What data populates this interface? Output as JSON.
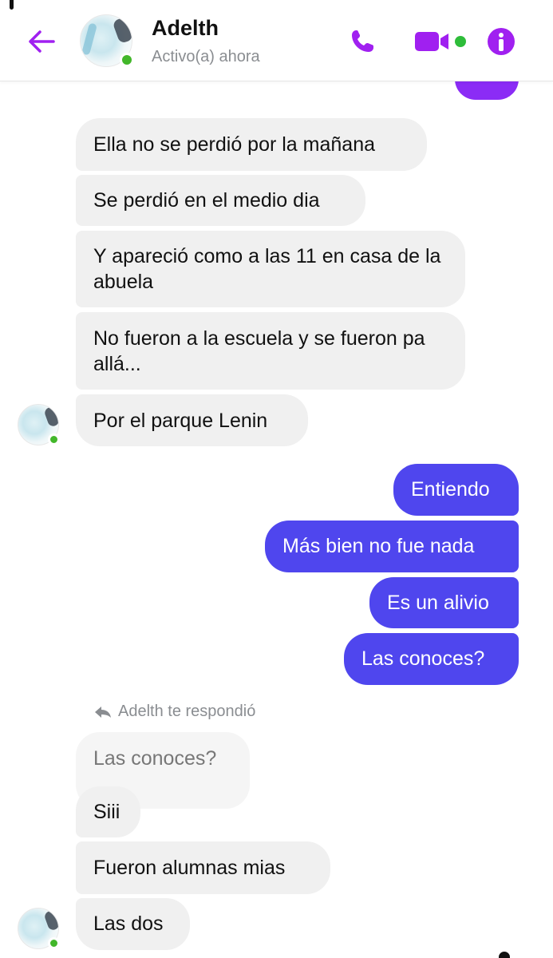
{
  "header": {
    "contact_name": "Adelth",
    "status": "Activo(a) ahora",
    "icons": [
      "back-arrow-icon",
      "phone-icon",
      "video-camera-icon",
      "info-icon"
    ]
  },
  "colors": {
    "accent": "#a020f0",
    "outgoing_bubble": "#4f46ee",
    "incoming_bubble": "#f0f0f0",
    "online": "#42b72a"
  },
  "messages": {
    "m1": "Ella no se perdió por la mañana",
    "m2": "Se perdió en el medio dia",
    "m3": "Y apareció como a las 11 en casa de la abuela",
    "m4": "No fueron a la escuela y se fueron pa allá...",
    "m5": "Por el parque Lenin",
    "o1": "Entiendo",
    "o2": "Más bien no fue nada",
    "o3": "Es un alivio",
    "o4": "Las conoces?",
    "reply_label": "Adelth te respondió",
    "quoted": "Las conoces?",
    "m6": "Siii",
    "m7": "Fueron alumnas mias",
    "m8": "Las dos"
  }
}
